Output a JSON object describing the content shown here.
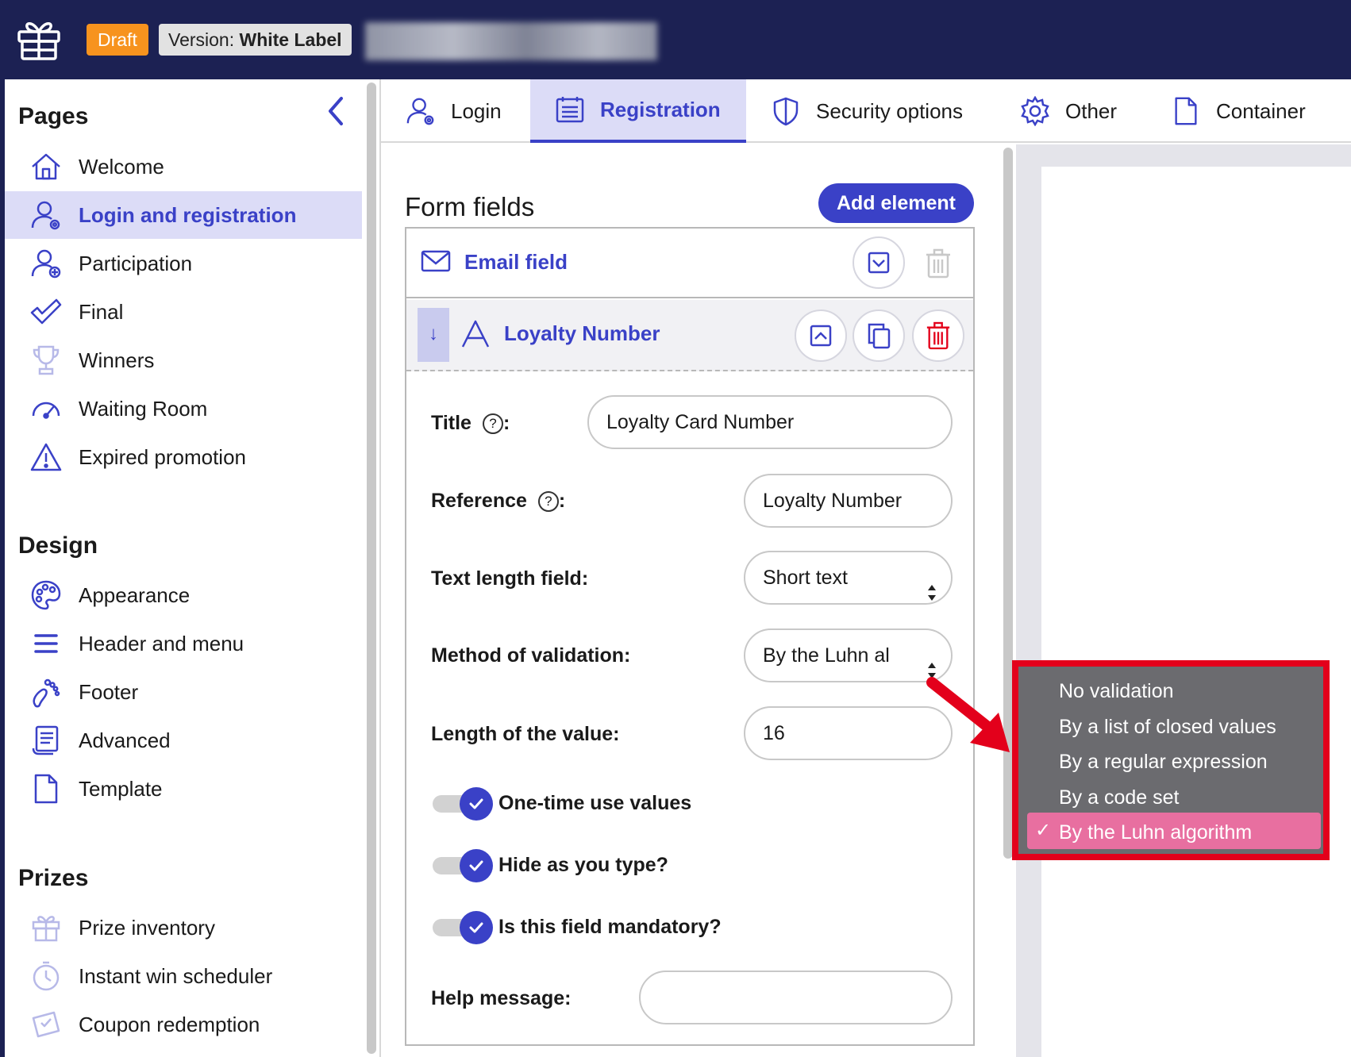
{
  "topbar": {
    "logo_icon": "gift-icon",
    "draft_label": "Draft",
    "version_prefix": "Version:",
    "version_value": "White Label"
  },
  "sidebar": {
    "pages_title": "Pages",
    "pages": [
      {
        "label": "Welcome",
        "icon": "home-icon"
      },
      {
        "label": "Login and registration",
        "icon": "user-at-icon",
        "active": true
      },
      {
        "label": "Participation",
        "icon": "user-plus-icon"
      },
      {
        "label": "Final",
        "icon": "check-icon"
      },
      {
        "label": "Winners",
        "icon": "trophy-icon"
      },
      {
        "label": "Waiting Room",
        "icon": "gauge-icon"
      },
      {
        "label": "Expired promotion",
        "icon": "warning-icon"
      }
    ],
    "design_title": "Design",
    "design": [
      {
        "label": "Appearance",
        "icon": "palette-icon"
      },
      {
        "label": "Header and menu",
        "icon": "menu-icon"
      },
      {
        "label": "Footer",
        "icon": "footprint-icon"
      },
      {
        "label": "Advanced",
        "icon": "scroll-icon"
      },
      {
        "label": "Template",
        "icon": "file-icon"
      }
    ],
    "prizes_title": "Prizes",
    "prizes": [
      {
        "label": "Prize inventory",
        "icon": "gift-icon"
      },
      {
        "label": "Instant win scheduler",
        "icon": "stopwatch-icon"
      },
      {
        "label": "Coupon redemption",
        "icon": "ticket-icon"
      }
    ]
  },
  "tabs": [
    {
      "label": "Login",
      "icon": "user-at-icon"
    },
    {
      "label": "Registration",
      "icon": "form-icon",
      "active": true
    },
    {
      "label": "Security options",
      "icon": "shield-icon"
    },
    {
      "label": "Other",
      "icon": "gear-icon"
    },
    {
      "label": "Container",
      "icon": "file-icon"
    }
  ],
  "form": {
    "title": "Form fields",
    "add_button": "Add element",
    "email_field": "Email field",
    "loyalty_field": "Loyalty Number",
    "drag_glyph": "↓",
    "title_label": "Title",
    "title_value": "Loyalty Card Number",
    "reference_label": "Reference",
    "reference_value": "Loyalty Number",
    "help_glyph": "?",
    "colon": ":",
    "text_length_label": "Text length field:",
    "text_length_value": "Short text",
    "validation_label": "Method of validation:",
    "validation_value": "By the Luhn al",
    "length_label": "Length of the value:",
    "length_value": "16",
    "toggles": [
      {
        "label": "One-time use values",
        "on": true
      },
      {
        "label": "Hide as you type?",
        "on": true
      },
      {
        "label": "Is this field mandatory?",
        "on": true
      }
    ],
    "help_message_label": "Help message:",
    "help_message_value": ""
  },
  "dropdown": {
    "options": [
      "No validation",
      "By a list of closed values",
      "By a regular expression",
      "By a code set",
      "By the Luhn algorithm"
    ],
    "selected_index": 4,
    "check_glyph": "✓"
  },
  "colors": {
    "navy": "#1c2153",
    "accent": "#3a41c7",
    "draft": "#f7931e",
    "highlight": "#e3001b",
    "selected": "#e86fa0"
  }
}
